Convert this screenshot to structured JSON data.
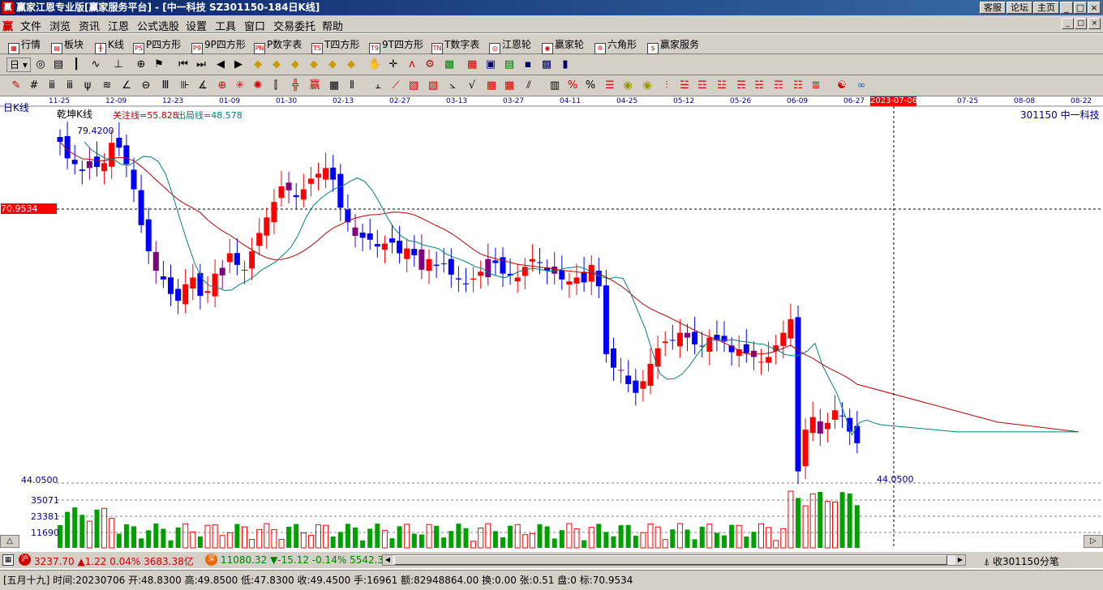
{
  "window": {
    "title": "赢家江恩专业版[赢家服务平台] - [中一科技   SZ301150-184日K线]",
    "btn_kefu": "客服",
    "btn_luntan": "论坛",
    "btn_home": "主页",
    "ctrl_min": "_",
    "ctrl_max": "□",
    "ctrl_close": "×",
    "logo": "赢"
  },
  "menu": {
    "items": [
      "文件",
      "浏览",
      "资讯",
      "江恩",
      "公式选股",
      "设置",
      "工具",
      "窗口",
      "交易委托",
      "帮助"
    ],
    "logo": "赢"
  },
  "toolbar1": {
    "items": [
      "行情",
      "板块",
      "K线",
      "P四方形",
      "9P四方形",
      "P数字表",
      "T四方形",
      "9T四方形",
      "T数字表",
      "江恩轮",
      "赢家轮",
      "六角形",
      "赢家服务"
    ]
  },
  "toolbar2": {
    "period": "日"
  },
  "chart": {
    "period_label": "日K线",
    "indicator_name": "乾坤K线",
    "legend_focus": "关注线=55.828",
    "legend_exit": "出局线=48.578",
    "stock_label": "301150  中一科技",
    "high_label": "79.4200",
    "low_label": "44.0500",
    "cursor_price": "70.9534",
    "cursor_date": "2023-07-06",
    "price_axis_low": "44.0500",
    "vol_ticks": [
      "35071",
      "23381",
      "11690"
    ],
    "date_ticks": [
      "11-25",
      "12-09",
      "12-23",
      "01-09",
      "01-30",
      "02-13",
      "02-27",
      "03-13",
      "03-27",
      "04-11",
      "04-25",
      "05-12",
      "05-26",
      "06-09",
      "06-27",
      "07-25",
      "08-08",
      "08-22"
    ],
    "colors": {
      "up": "#ff0000",
      "down": "#0000ff",
      "mixed": "#800080",
      "focus_line": "#c00000",
      "exit_line": "#008080",
      "volume_up": "#ff0000",
      "volume_down": "#00a000"
    }
  },
  "chart_data": {
    "type": "candlestick",
    "title": "乾坤K线",
    "x_range": [
      "11-25",
      "08-22"
    ],
    "y_range": [
      44.05,
      79.42
    ],
    "values_close": [
      78.5,
      76.8,
      76.2,
      75.5,
      76.5,
      75.9,
      76.3,
      78.4,
      77.9,
      76.2,
      73.6,
      69.9,
      67.2,
      65.2,
      64.3,
      62.8,
      62.1,
      63.8,
      64.5,
      62.6,
      63.1,
      64.9,
      65.5,
      67.0,
      65.8,
      65.3,
      67.2,
      69.1,
      70.7,
      72.3,
      73.9,
      73.5,
      72.8,
      73.6,
      74.7,
      75.2,
      75.8,
      74.6,
      71.7,
      70.2,
      68.8,
      68.6,
      68.4,
      67.7,
      68.0,
      68.1,
      67.0,
      67.5,
      66.8,
      65.3,
      66.4,
      65.7,
      65.9,
      64.8,
      64.3,
      63.8,
      64.4,
      65.1,
      66.4,
      66.0,
      64.9,
      64.7,
      64.5,
      65.6,
      66.4,
      66.0,
      65.2,
      64.9,
      64.3,
      64.1,
      64.5,
      64.0,
      65.8,
      63.6,
      56.6,
      55.2,
      54.9,
      53.5,
      52.6,
      53.8,
      55.6,
      57.2,
      57.9,
      58.0,
      58.8,
      58.3,
      57.6,
      57.4,
      58.3,
      58.0,
      57.9,
      56.8,
      57.1,
      56.7,
      56.3,
      55.8,
      56.3,
      57.5,
      58.8,
      60.2,
      44.5,
      48.8,
      50.1,
      48.4,
      49.5,
      50.8,
      50.2,
      48.6,
      47.4
    ],
    "focus_line_value": 55.828,
    "exit_line_value": 48.578,
    "volume_ticks": [
      11690,
      23381,
      35071
    ]
  },
  "status": {
    "sh_icon": "沪",
    "sh_text": "3237.70 ▲1.22 0.04% 3683.38亿",
    "sz_icon": "深",
    "sz_text": "11080.32 ▼-15.12 -0.14% 5542.3",
    "right_text": "收301150分笔"
  },
  "info": {
    "text": "[五月十九] 时间:20230706 开:48.8300 高:49.8500 低:47.8300 收:49.4500 手:16961 额:82948864.00 换:0.00 张:0.51 盘:0 标:70.9534"
  }
}
